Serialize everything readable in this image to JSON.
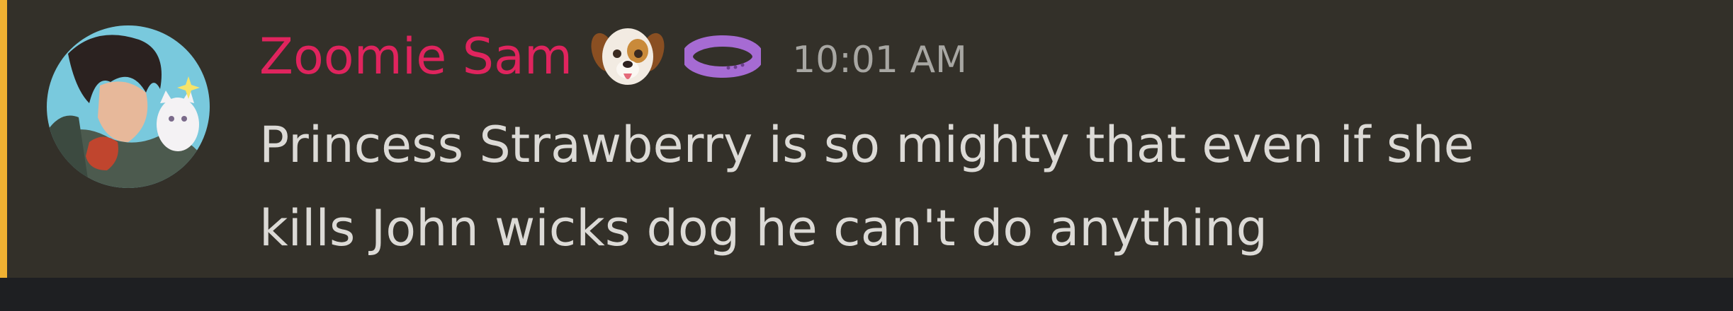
{
  "message": {
    "author": "Zoomie Sam",
    "timestamp": "10:01 AM",
    "content_lines": [
      "Princess Strawberry is so mighty that even if she",
      "kills John wicks dog he can't do anything"
    ],
    "author_color": "#e0245e",
    "highlight_color": "#f0b132",
    "badges": [
      "dog-emoji-icon",
      "collar-icon"
    ]
  }
}
